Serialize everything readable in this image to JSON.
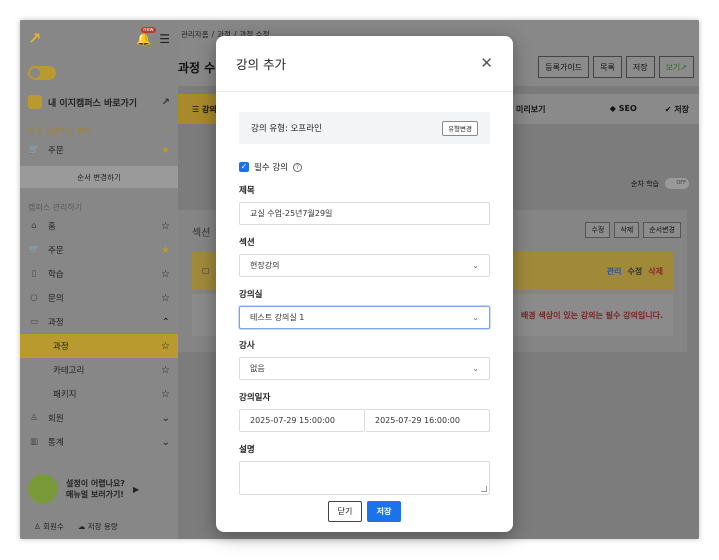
{
  "sidebar": {
    "new_badge": "new",
    "easy_link": "내 이지캠퍼스 바로가기",
    "frequent_title": "자주 사용하는 메뉴",
    "frequent_items": [
      {
        "label": "주문"
      }
    ],
    "order_change": "순서 변경하기",
    "campus_title": "캠퍼스 관리하기",
    "items": [
      {
        "label": "홈"
      },
      {
        "label": "주문"
      },
      {
        "label": "학습"
      },
      {
        "label": "문의"
      },
      {
        "label": "과정"
      }
    ],
    "subitems": [
      {
        "label": "과정"
      },
      {
        "label": "카테고리"
      },
      {
        "label": "패키지"
      }
    ],
    "items2": [
      {
        "label": "회원"
      },
      {
        "label": "통계"
      }
    ],
    "help_line1": "설정이 어렵나요?",
    "help_line2": "매뉴얼 보러가기!",
    "footer_members": "회원수",
    "footer_storage": "저장 용량"
  },
  "main": {
    "breadcrumb": [
      "관리자홈",
      "과정",
      "과정 수정"
    ],
    "title": "과정 수",
    "top_buttons": [
      "등록가이드",
      "목록",
      "저장",
      "보기"
    ],
    "tab_first": "강의",
    "tab_preview": "미리보기",
    "tab_seo": "SEO",
    "tab_save": "저장",
    "sequential_label": "순차 학습",
    "toggle_off": "OFF",
    "section_label": "섹션",
    "card_buttons": [
      "수정",
      "삭제",
      "순서변경"
    ],
    "row_actions": [
      "관리",
      "수정",
      "삭제"
    ],
    "required_note": "배경 색상이 있는 강의는 필수 강의입니다."
  },
  "modal": {
    "title": "강의 추가",
    "type_label": "강의 유형: 오프라인",
    "type_change": "유형변경",
    "required_label": "필수 강의",
    "title_label": "제목",
    "title_value": "교실 수업-25년7월29일",
    "section_label": "섹션",
    "section_value": "현장강의",
    "room_label": "강의실",
    "room_value": "테스트 강의실 1",
    "instructor_label": "강사",
    "instructor_value": "없음",
    "date_label": "강의일자",
    "date_start": "2025-07-29 15:00:00",
    "date_end": "2025-07-29 16:00:00",
    "desc_label": "설명",
    "close_button": "닫기",
    "save_button": "저장"
  },
  "colors": {
    "accent": "#1a73e8",
    "brand_yellow": "#f0c419",
    "danger": "#c0392b"
  }
}
